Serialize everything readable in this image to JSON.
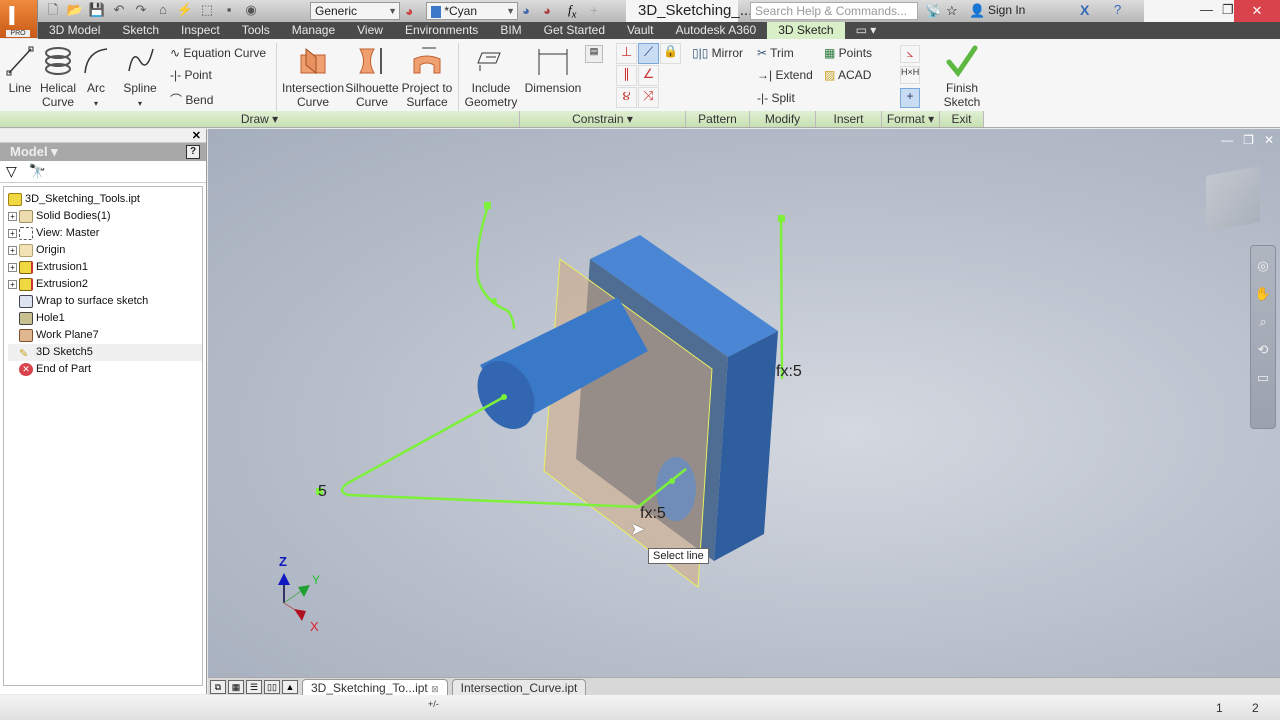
{
  "app": {
    "logo_label": "PRO",
    "document_title": "3D_Sketching_...",
    "search_placeholder": "Search Help & Commands...",
    "sign_in_label": "Sign In",
    "material_value": "Generic",
    "appearance_value": "*Cyan"
  },
  "menu_tabs": [
    {
      "label": "3D Model"
    },
    {
      "label": "Sketch"
    },
    {
      "label": "Inspect"
    },
    {
      "label": "Tools"
    },
    {
      "label": "Manage"
    },
    {
      "label": "View"
    },
    {
      "label": "Environments"
    },
    {
      "label": "BIM"
    },
    {
      "label": "Get Started"
    },
    {
      "label": "Vault"
    },
    {
      "label": "Autodesk A360"
    },
    {
      "label": "3D Sketch"
    }
  ],
  "ribbon": {
    "draw": {
      "line": "Line",
      "helical": "Helical\nCurve",
      "helical_1": "Helical",
      "helical_2": "Curve",
      "arc": "Arc",
      "spline": "Spline",
      "equation_curve": "Equation Curve",
      "point": "Point",
      "bend": "Bend",
      "intersection_1": "Intersection",
      "intersection_2": "Curve",
      "silhouette_1": "Silhouette",
      "silhouette_2": "Curve",
      "project_1": "Project to",
      "project_2": "Surface",
      "include_1": "Include",
      "include_2": "Geometry",
      "panel_label": "Draw ▾"
    },
    "constrain": {
      "dimension": "Dimension",
      "panel_label": "Constrain ▾"
    },
    "pattern": {
      "mirror": "Mirror",
      "panel_label": "Pattern"
    },
    "modify": {
      "trim": "Trim",
      "extend": "Extend",
      "split": "Split",
      "panel_label": "Modify"
    },
    "insert": {
      "points": "Points",
      "acad": "ACAD",
      "panel_label": "Insert"
    },
    "format": {
      "panel_label": "Format ▾"
    },
    "exit": {
      "finish_1": "Finish",
      "finish_2": "Sketch",
      "panel_label": "Exit"
    }
  },
  "browser": {
    "title": "Model ▾",
    "nodes": [
      {
        "label": "3D_Sketching_Tools.ipt",
        "expandable": false,
        "root": true
      },
      {
        "label": "Solid Bodies(1)",
        "expandable": true
      },
      {
        "label": "View: Master",
        "expandable": true
      },
      {
        "label": "Origin",
        "expandable": true
      },
      {
        "label": "Extrusion1",
        "expandable": true
      },
      {
        "label": "Extrusion2",
        "expandable": true
      },
      {
        "label": "Wrap to surface sketch",
        "expandable": false
      },
      {
        "label": "Hole1",
        "expandable": false
      },
      {
        "label": "Work Plane7",
        "expandable": false
      },
      {
        "label": "3D Sketch5",
        "expandable": false,
        "selected": true
      },
      {
        "label": "End of Part",
        "expandable": false
      }
    ]
  },
  "viewport": {
    "tooltip": "Select line",
    "dim_labels": [
      "fx:5",
      "fx:5",
      "5"
    ],
    "axis_labels": {
      "x": "X",
      "y": "Y",
      "z": "Z"
    }
  },
  "doc_tabs": [
    {
      "label": "3D_Sketching_To...ipt",
      "active": true
    },
    {
      "label": "Intersection_Curve.ipt",
      "active": false
    }
  ],
  "status": {
    "page_1": "1",
    "page_2": "2",
    "dim_toggle": "+/-"
  },
  "colors": {
    "sketch_green": "#7cf03a",
    "part_blue": "#3a78c8",
    "active_tab": "#d8efc8",
    "close_red": "#d9434b"
  }
}
